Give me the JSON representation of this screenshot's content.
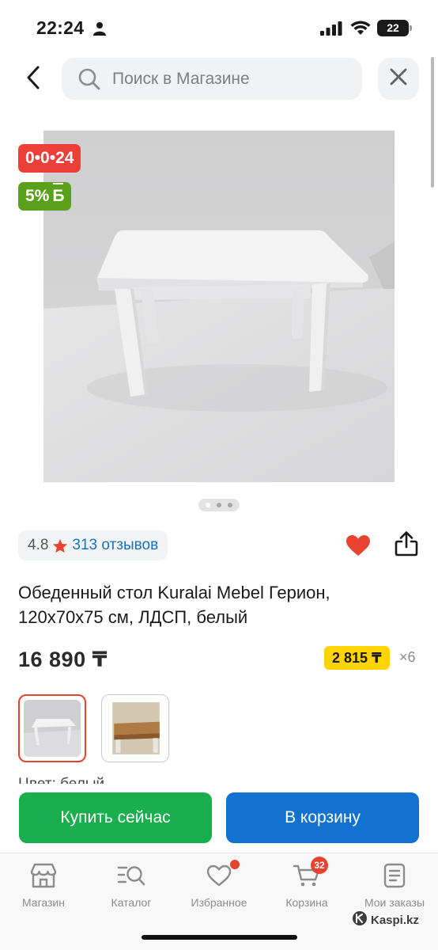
{
  "status_bar": {
    "time": "22:24",
    "battery": "22"
  },
  "search": {
    "placeholder": "Поиск в Магазине"
  },
  "badges": {
    "timer": "0•0•24",
    "bonus_percent": "5%",
    "bonus_symbol": "Б"
  },
  "rating": {
    "value": "4.8",
    "reviews": "313 отзывов"
  },
  "product": {
    "title": "Обеденный стол Kuralai Mebel Герион, 120х70х75 см, ЛДСП, белый",
    "price": "16 890 ₸",
    "installment_price": "2 815 ₸",
    "installment_times": "×6",
    "color_label": "Цвет: белый"
  },
  "actions": {
    "buy_now": "Купить сейчас",
    "add_to_cart": "В корзину"
  },
  "tab_bar": {
    "items": [
      {
        "label": "Магазин",
        "icon": "store-icon"
      },
      {
        "label": "Каталог",
        "icon": "catalog-search-icon"
      },
      {
        "label": "Избранное",
        "icon": "heart-icon"
      },
      {
        "label": "Корзина",
        "icon": "cart-icon",
        "badge": "32"
      },
      {
        "label": "Мои заказы",
        "icon": "orders-icon"
      }
    ]
  },
  "watermark": "Kaspi.kz",
  "colors": {
    "accent_red": "#ed3f3a",
    "bonus_green": "#5aa11b",
    "buy_green": "#19ae4e",
    "cart_blue": "#1372cf",
    "installment_yellow": "#ffd400"
  }
}
